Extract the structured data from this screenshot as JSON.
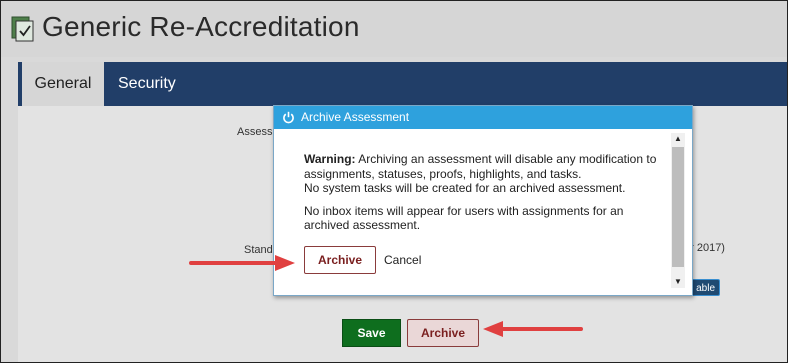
{
  "header": {
    "title": "Generic Re-Accreditation",
    "icon": "document-check-icon"
  },
  "tabs": [
    {
      "label": "General",
      "active": true
    },
    {
      "label": "Security",
      "active": false
    }
  ],
  "background_fragments": {
    "assessment_label_fragment": "Assess",
    "standard_label_fragment": "Stand",
    "date_fragment": "er 2017)",
    "badge_fragment": "able"
  },
  "footer_buttons": {
    "save_label": "Save",
    "archive_label": "Archive"
  },
  "modal": {
    "title": "Archive Assessment",
    "title_icon": "power-icon",
    "warning_bold": "Warning:",
    "warning_text": " Archiving an assessment will disable any modification to assignments, statuses, proofs, highlights, and tasks.",
    "line2": "No system tasks will be created for an archived assessment.",
    "line3": "No inbox items will appear for users with assignments for an archived assessment.",
    "archive_button": "Archive",
    "cancel_link": "Cancel"
  },
  "colors": {
    "tab_bar": "#213e68",
    "modal_header": "#2ea1dd",
    "save_green": "#0e6e1e",
    "archive_border": "#8a3b3b",
    "annotation_arrow": "#e04040"
  }
}
